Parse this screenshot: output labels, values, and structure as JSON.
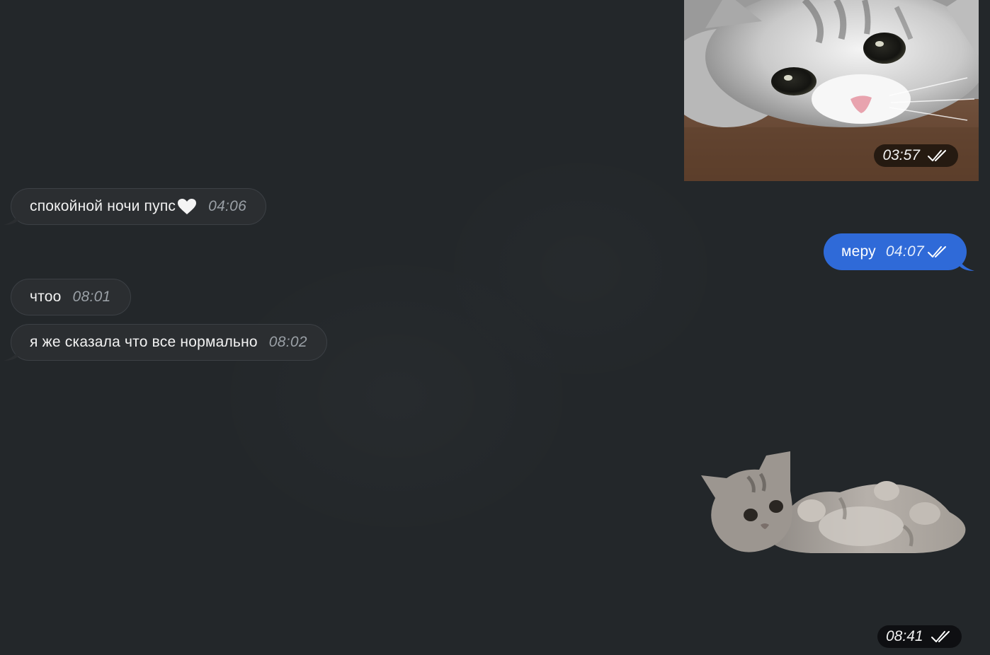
{
  "messages": {
    "photo": {
      "time": "03:57",
      "status": "read"
    },
    "goodnight": {
      "text": "спокойной ночи пупс",
      "emoji": "white-heart",
      "time": "04:06"
    },
    "reply": {
      "text": "меру",
      "time": "04:07",
      "status": "read"
    },
    "what": {
      "text": "чтоо",
      "time": "08:01"
    },
    "said": {
      "text": "я же сказала что все нормально",
      "time": "08:02"
    },
    "sticker": {
      "time": "08:41",
      "status": "read"
    }
  },
  "colors": {
    "background": "#23272a",
    "incoming_bubble": "#2b2e31",
    "outgoing_bubble": "#2f6ad8",
    "timestamp": "#9aa0a6"
  }
}
